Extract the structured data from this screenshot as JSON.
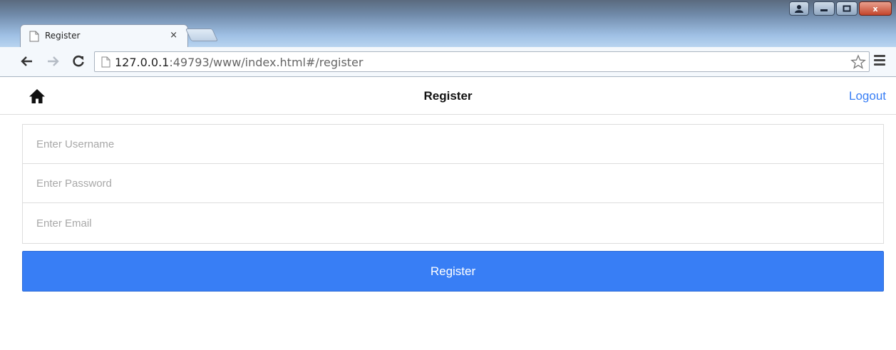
{
  "browser": {
    "tab_title": "Register",
    "tab_close": "×",
    "url_host": "127.0.0.1",
    "url_rest": ":49793/www/index.html#/register",
    "window_controls": {
      "user": "👤",
      "minimize": "—",
      "maximize": "☐",
      "close": "x"
    },
    "icons": {
      "back": "back-arrow-icon",
      "forward": "forward-arrow-icon",
      "reload": "reload-icon",
      "bookmark": "star-icon",
      "menu": "hamburger-menu-icon"
    }
  },
  "app": {
    "header": {
      "title": "Register",
      "logout_label": "Logout",
      "home_icon": "home-icon"
    },
    "form": {
      "username_placeholder": "Enter Username",
      "password_placeholder": "Enter Password",
      "email_placeholder": "Enter Email",
      "username_value": "",
      "password_value": "",
      "email_value": ""
    },
    "register_button_label": "Register"
  },
  "colors": {
    "accent": "#387ef5",
    "border": "#dddddd",
    "placeholder": "#a8a8a8"
  }
}
